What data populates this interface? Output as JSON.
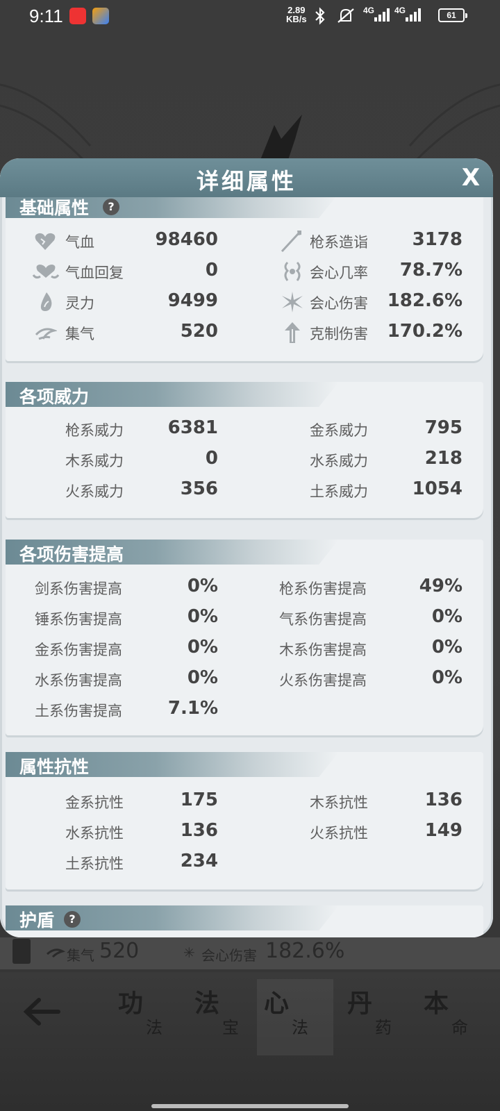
{
  "status_bar": {
    "time": "9:11",
    "speed_value": "2.89",
    "speed_unit": "KB/s",
    "net1": "4G",
    "net2": "4G",
    "battery": "61"
  },
  "dialog": {
    "title": "详细属性",
    "close": "X"
  },
  "basic": {
    "title": "基础属性",
    "help": "?",
    "left": [
      {
        "label": "气血",
        "value": "98460",
        "icon": "blood-icon"
      },
      {
        "label": "气血回复",
        "value": "0",
        "icon": "blood-regen-icon"
      },
      {
        "label": "灵力",
        "value": "9499",
        "icon": "spirit-icon"
      },
      {
        "label": "集气",
        "value": "520",
        "icon": "qi-gather-icon"
      }
    ],
    "right": [
      {
        "label": "枪系造诣",
        "value": "3178",
        "icon": "spear-icon"
      },
      {
        "label": "会心几率",
        "value": "78.7%",
        "icon": "crit-rate-icon"
      },
      {
        "label": "会心伤害",
        "value": "182.6%",
        "icon": "crit-damage-icon"
      },
      {
        "label": "克制伤害",
        "value": "170.2%",
        "icon": "counter-damage-icon"
      }
    ]
  },
  "power": {
    "title": "各项威力",
    "left": [
      {
        "label": "枪系威力",
        "value": "6381"
      },
      {
        "label": "木系威力",
        "value": "0"
      },
      {
        "label": "火系威力",
        "value": "356"
      }
    ],
    "right": [
      {
        "label": "金系威力",
        "value": "795"
      },
      {
        "label": "水系威力",
        "value": "218"
      },
      {
        "label": "土系威力",
        "value": "1054"
      }
    ]
  },
  "damage": {
    "title": "各项伤害提高",
    "left": [
      {
        "label": "剑系伤害提高",
        "value": "0%"
      },
      {
        "label": "锤系伤害提高",
        "value": "0%"
      },
      {
        "label": "金系伤害提高",
        "value": "0%"
      },
      {
        "label": "水系伤害提高",
        "value": "0%"
      },
      {
        "label": "土系伤害提高",
        "value": "7.1%"
      }
    ],
    "right": [
      {
        "label": "枪系伤害提高",
        "value": "49%"
      },
      {
        "label": "气系伤害提高",
        "value": "0%"
      },
      {
        "label": "木系伤害提高",
        "value": "0%"
      },
      {
        "label": "火系伤害提高",
        "value": "0%"
      }
    ]
  },
  "resist": {
    "title": "属性抗性",
    "left": [
      {
        "label": "金系抗性",
        "value": "175"
      },
      {
        "label": "水系抗性",
        "value": "136"
      },
      {
        "label": "土系抗性",
        "value": "234"
      }
    ],
    "right": [
      {
        "label": "木系抗性",
        "value": "136"
      },
      {
        "label": "火系抗性",
        "value": "149"
      }
    ]
  },
  "shield": {
    "title": "护盾",
    "help": "?"
  },
  "background": {
    "qi_label": "集气",
    "qi_value": "520",
    "crit_label": "会心伤害",
    "crit_value": "182.6%"
  },
  "nav": {
    "tabs": [
      {
        "big": "功",
        "small": "法"
      },
      {
        "big": "法",
        "small": "宝"
      },
      {
        "big": "心",
        "small": "法"
      },
      {
        "big": "丹",
        "small": "药"
      },
      {
        "big": "本",
        "small": "命"
      }
    ]
  }
}
